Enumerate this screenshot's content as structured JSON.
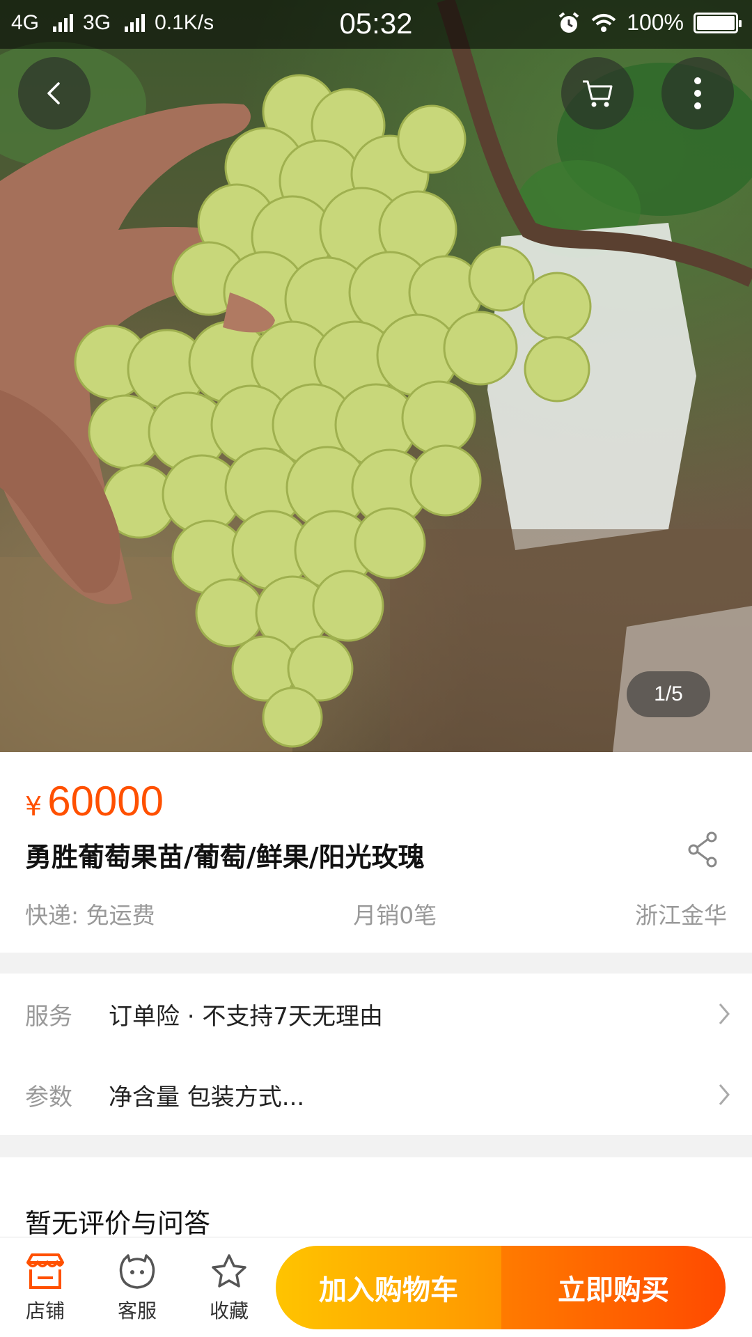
{
  "status_bar": {
    "network1": "4G",
    "network2": "3G",
    "speed": "0.1K/s",
    "time": "05:32",
    "battery": "100%",
    "battery_level": 1.0
  },
  "gallery": {
    "indicator": "1/5",
    "current": 1,
    "total": 5
  },
  "product": {
    "currency": "¥",
    "price": "60000",
    "title": "勇胜葡萄果苗/葡萄/鲜果/阳光玫瑰",
    "shipping": "快递: 免运费",
    "monthly_sales": "月销0笔",
    "location": "浙江金华"
  },
  "service": {
    "label": "服务",
    "value": "订单险 · 不支持7天无理由"
  },
  "params": {
    "label": "参数",
    "value": "净含量 包装方式..."
  },
  "reviews": {
    "title": "暂无评价与问答"
  },
  "bottom_bar": {
    "shop": "店铺",
    "support": "客服",
    "favorite": "收藏",
    "add_to_cart": "加入购物车",
    "buy_now": "立即购买"
  },
  "colors": {
    "accent": "#ff5000",
    "cart_gradient": [
      "#ffc400",
      "#ff9600"
    ],
    "buy_gradient": [
      "#ff7b00",
      "#ff4a00"
    ]
  }
}
